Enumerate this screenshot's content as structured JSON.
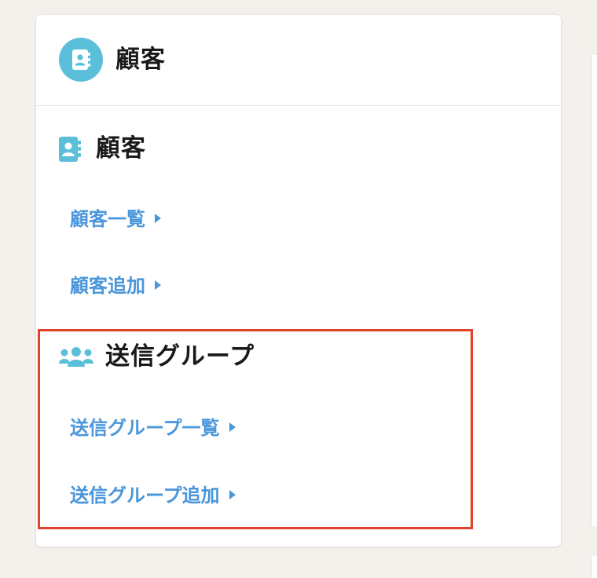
{
  "header": {
    "title": "顧客",
    "icon": "address-book-icon",
    "icon_bg_color": "#5bbfd9"
  },
  "sections": [
    {
      "heading": "顧客",
      "icon": "address-book-icon",
      "links": [
        {
          "label": "顧客一覧"
        },
        {
          "label": "顧客追加"
        }
      ]
    },
    {
      "heading": "送信グループ",
      "icon": "users-group-icon",
      "highlighted": true,
      "links": [
        {
          "label": "送信グループ一覧"
        },
        {
          "label": "送信グループ追加"
        }
      ]
    }
  ],
  "colors": {
    "accent_icon": "#5bbfd9",
    "link": "#4a96db",
    "highlight_border": "#e0442c",
    "background": "#f4f1ec"
  }
}
